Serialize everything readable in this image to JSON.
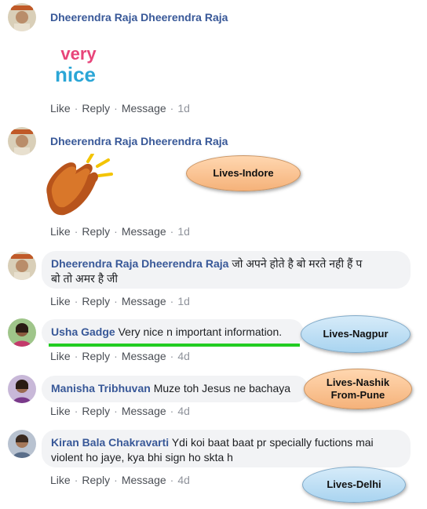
{
  "actions": {
    "like": "Like",
    "reply": "Reply",
    "message": "Message"
  },
  "comments": [
    {
      "author": "Dheerendra Raja Dheerendra Raja",
      "text": "",
      "sticker": "very-nice-sticker",
      "sticker_text_top": "very",
      "sticker_text_bottom": "nice",
      "time": "1d"
    },
    {
      "author": "Dheerendra Raja Dheerendra Raja",
      "text": "",
      "sticker": "clapping-hands-sticker",
      "time": "1d"
    },
    {
      "author": "Dheerendra Raja Dheerendra Raja",
      "text_line1": "जो अपने होते है बो मरते नही हैं प",
      "text_line2": "बो तो अमर है जी",
      "time": "1d"
    },
    {
      "author": "Usha Gadge",
      "text": "Very nice n important information.",
      "time": "4d"
    },
    {
      "author": "Manisha Tribhuvan",
      "text": "Muze toh Jesus ne bachaya",
      "time": "4d"
    },
    {
      "author": "Kiran Bala Chakravarti",
      "text_line1": "Ydi koi baat baat pr specially fuctions mai",
      "text_line2": "violent ho jaye, kya bhi sign ho skta h",
      "time": "4d"
    }
  ],
  "annotations": [
    {
      "label": "Lives-Indore",
      "color": "#f5b27a"
    },
    {
      "label": "Lives-Nagpur",
      "color": "#a9d4f0"
    },
    {
      "label_line1": "Lives-Nashik",
      "label_line2": "From-Pune",
      "color": "#f5b27a"
    },
    {
      "label": "Lives-Delhi",
      "color": "#a9d4f0"
    }
  ],
  "highlight_color": "#22cc22"
}
